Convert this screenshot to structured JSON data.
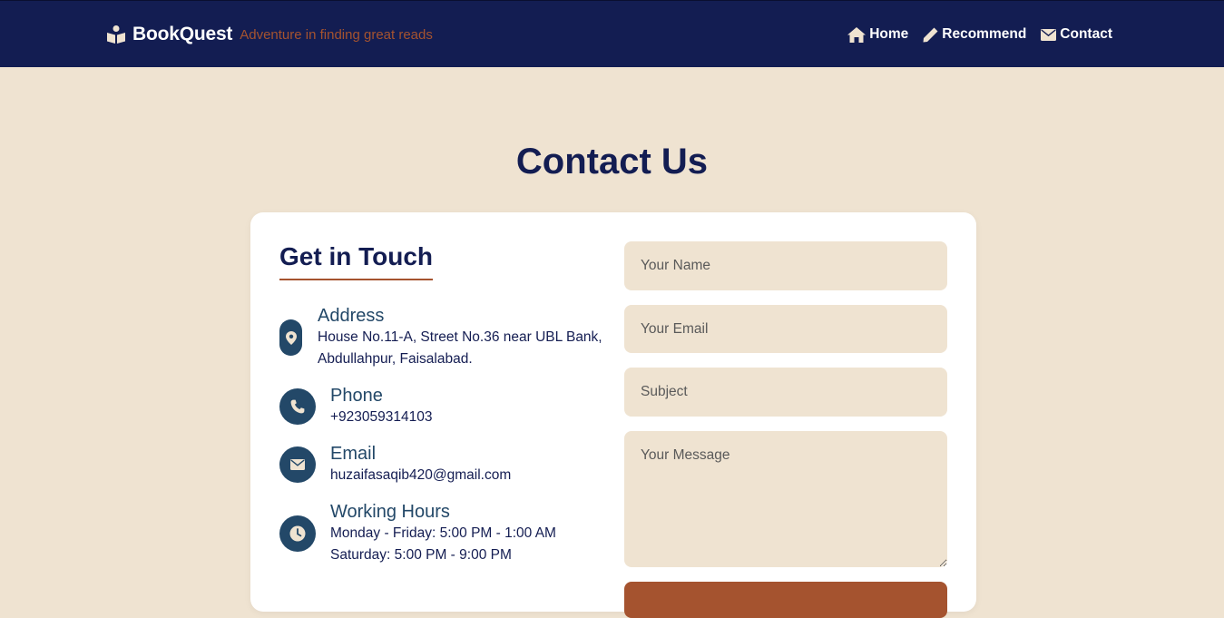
{
  "brand": {
    "name": "BookQuest",
    "tagline": "Adventure in finding great reads"
  },
  "nav": {
    "home": "Home",
    "recommend": "Recommend",
    "contact": "Contact"
  },
  "page": {
    "title": "Contact Us"
  },
  "contact_info": {
    "heading": "Get in Touch",
    "address": {
      "title": "Address",
      "line1": "House No.11-A, Street No.36 near UBL Bank,",
      "line2": "Abdullahpur, Faisalabad."
    },
    "phone": {
      "title": "Phone",
      "value": "+923059314103"
    },
    "email": {
      "title": "Email",
      "value": "huzaifasaqib420@gmail.com"
    },
    "hours": {
      "title": "Working Hours",
      "line1": "Monday - Friday: 5:00 PM - 1:00 AM",
      "line2": "Saturday: 5:00 PM - 9:00 PM"
    }
  },
  "form": {
    "name_placeholder": "Your Name",
    "email_placeholder": "Your Email",
    "subject_placeholder": "Subject",
    "message_placeholder": "Your Message",
    "submit_label": ""
  },
  "colors": {
    "navbar": "#131d52",
    "background": "#efe3d1",
    "accent": "#a5532f",
    "icon_circle": "#234868"
  }
}
